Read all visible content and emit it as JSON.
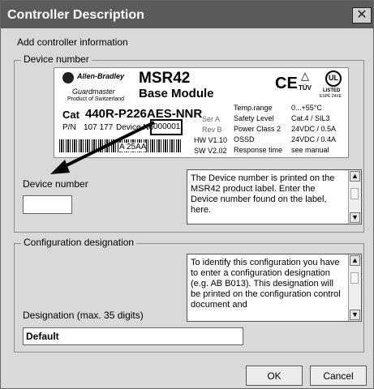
{
  "window": {
    "title": "Controller Description",
    "close_glyph": "✕",
    "subtitle": "Add controller information"
  },
  "device_group": {
    "legend": "Device number",
    "field_label": "Device number",
    "field_value": "",
    "help_text": "The Device number is printed on the MSR42 product label. Enter the Device number found on the label, here."
  },
  "product_label": {
    "brand": "Allen-Bradley",
    "sub_brand": "Guardmaster",
    "origin": "Product of Switzerland",
    "model": "MSR42",
    "module": "Base Module",
    "cert_ce": "CE",
    "cert_tuv": "TÜV",
    "cert_ul": "UL",
    "cert_listed": "LISTED",
    "cert_espe": "ESPE 24XE",
    "cat_prefix": "Cat",
    "catalog_number": "440R-P226AES-NNR",
    "pn_prefix": "P/N",
    "part_number": "107 177",
    "device_no_label": "Device No",
    "device_no": "000001",
    "serial": "A    25AA",
    "ser": "Ser A",
    "rev": "Rev B",
    "hw": "HW V1.10",
    "sw": "SW V2.02",
    "spec_labels": [
      "Temp.range",
      "Safety Level",
      "Power Class 2",
      "OSSD",
      "Response time"
    ],
    "spec_values": [
      "0...+55°C",
      "Cat.4 / SIL3",
      "24VDC / 0.5A",
      "24VDC / 0.4A",
      "see manual"
    ]
  },
  "config_group": {
    "legend": "Configuration designation",
    "help_text": "To identify this configuration you have to enter a configuration designation (e.g. AB B013). This designation will be printed on the configuration control document and",
    "field_label": "Designation (max. 35 digits)",
    "field_value": "Default"
  },
  "scrollbar": {
    "up_glyph": "▲",
    "down_glyph": "▼"
  },
  "buttons": {
    "ok": "OK",
    "cancel": "Cancel"
  }
}
